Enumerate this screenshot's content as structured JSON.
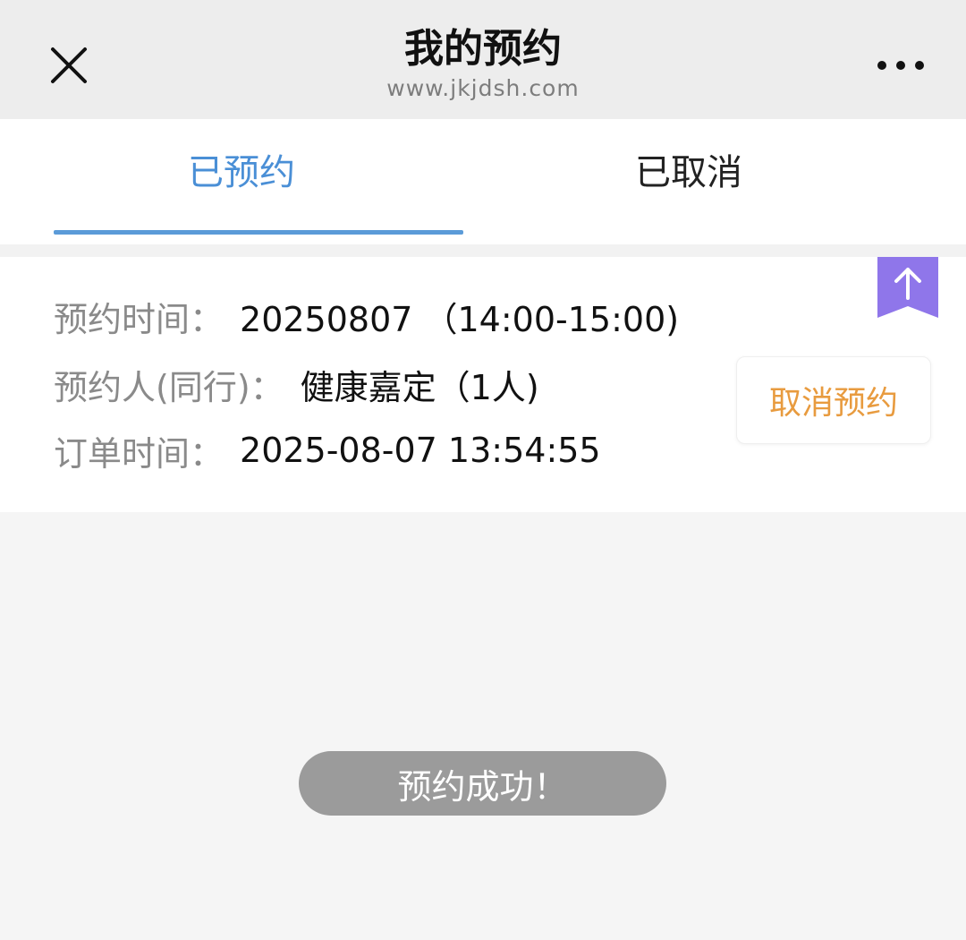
{
  "header": {
    "title": "我的预约",
    "subtitle": "www.jkjdsh.com",
    "close_icon": "close-icon",
    "more_icon": "more-icon"
  },
  "tabs": [
    {
      "label": "已预约",
      "active": true
    },
    {
      "label": "已取消",
      "active": false
    }
  ],
  "reservation": {
    "time_label": "预约时间：",
    "time_value": "20250807 （14:00-15:00)",
    "person_label": "预约人(同行)：",
    "person_value": "健康嘉定（1人)",
    "order_label": "订单时间：",
    "order_value": "2025-08-07 13:54:55",
    "cancel_button": "取消预约"
  },
  "toast": {
    "message": "预约成功！"
  },
  "colors": {
    "accent": "#4a8fd6",
    "cancel": "#e89b3f",
    "badge": "#8f76ea"
  },
  "icons": {
    "top_badge": "arrow-up-icon"
  }
}
